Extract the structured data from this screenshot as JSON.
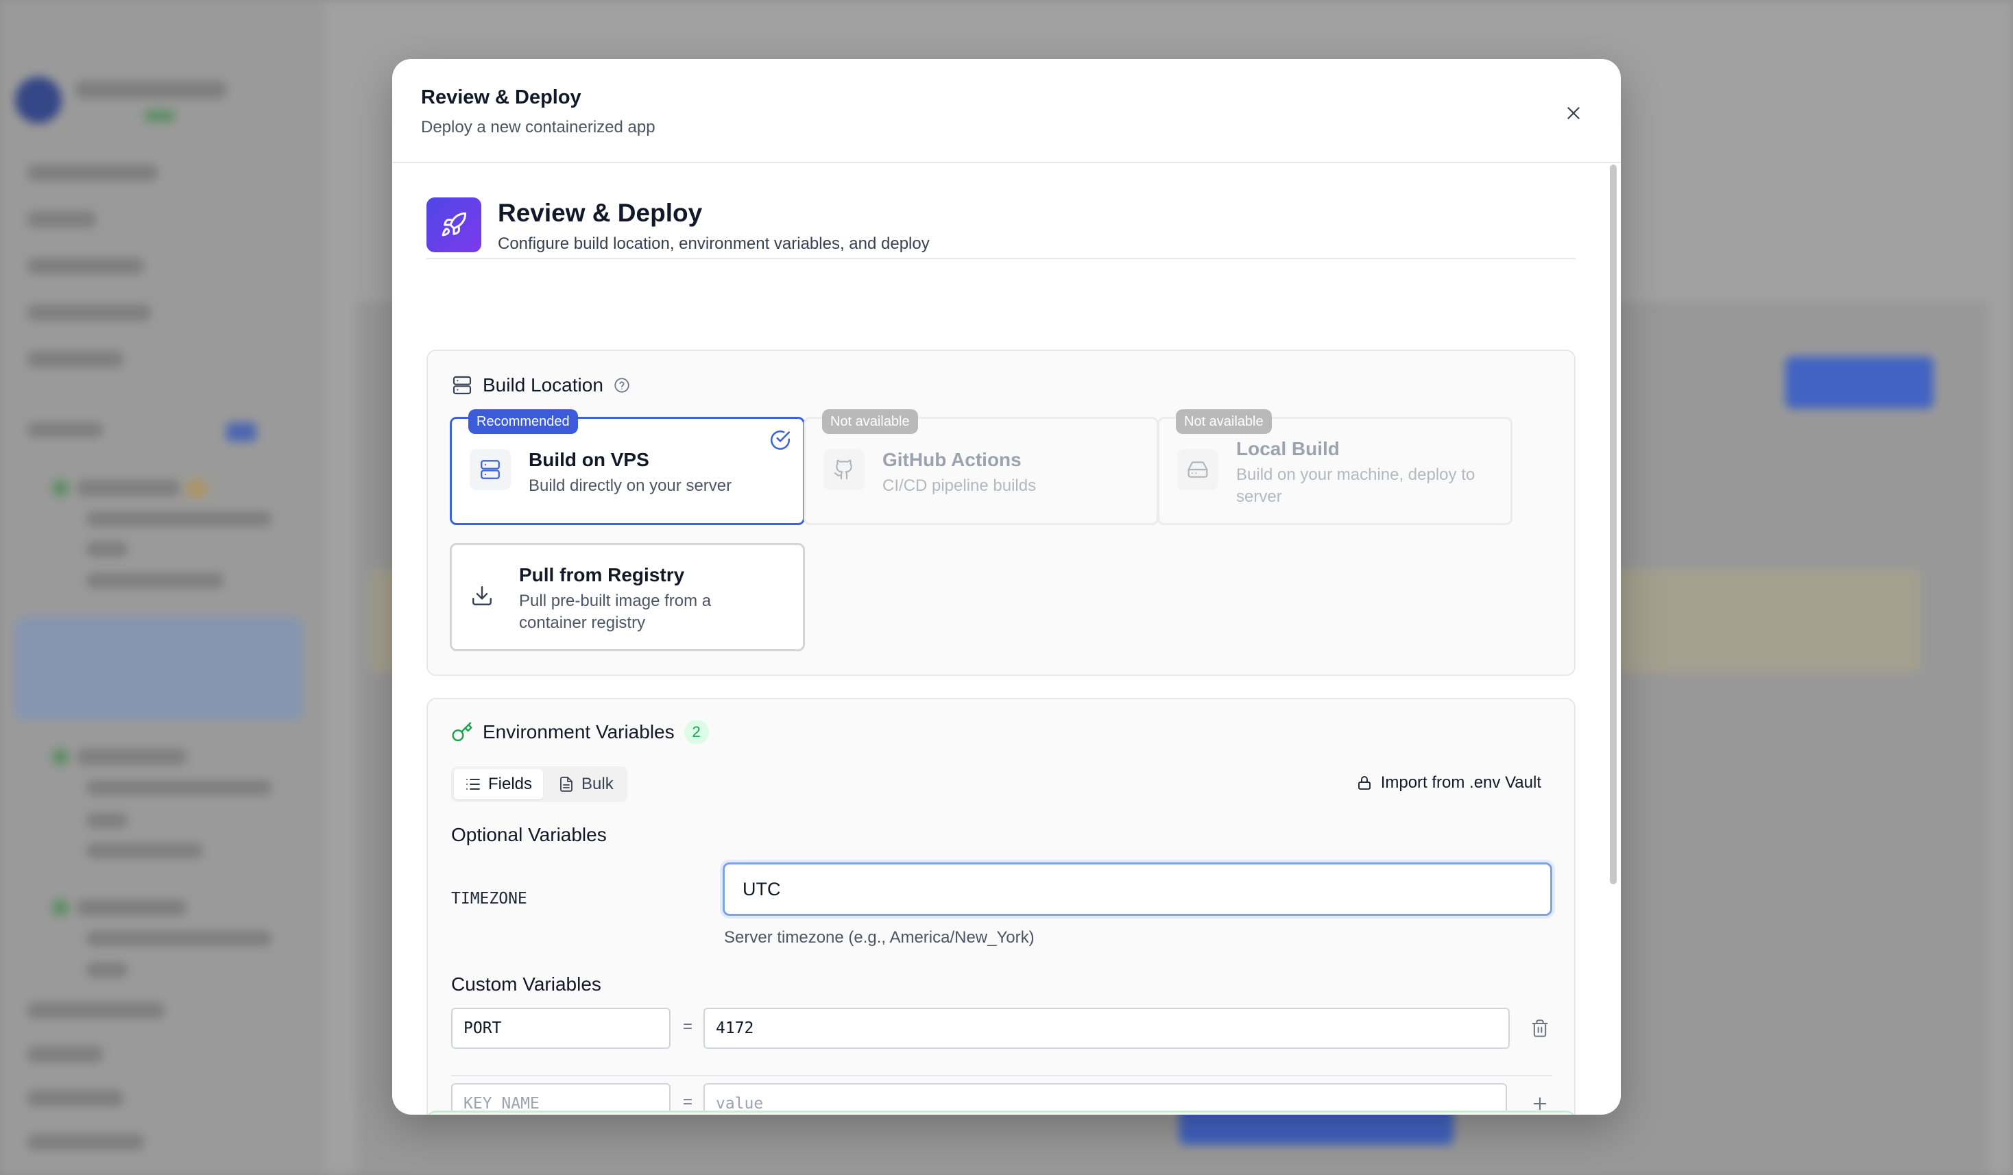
{
  "modal": {
    "title": "Review & Deploy",
    "subtitle": "Deploy a new containerized app"
  },
  "hero": {
    "title": "Review & Deploy",
    "subtitle": "Configure build location, environment variables, and deploy"
  },
  "build_location": {
    "title": "Build Location",
    "options": [
      {
        "title": "Build on VPS",
        "description": "Build directly on your server",
        "tag": "Recommended",
        "selected": true,
        "available": true,
        "icon": "server-icon"
      },
      {
        "title": "GitHub Actions",
        "description": "CI/CD pipeline builds",
        "tag": "Not available",
        "selected": false,
        "available": false,
        "icon": "github-icon"
      },
      {
        "title": "Local Build",
        "description": "Build on your machine, deploy to server",
        "tag": "Not available",
        "selected": false,
        "available": false,
        "icon": "hard-drive-icon"
      },
      {
        "title": "Pull from Registry",
        "description": "Pull pre-built image from a container registry",
        "tag": "",
        "selected": false,
        "available": true,
        "icon": "download-icon"
      }
    ]
  },
  "env": {
    "title": "Environment Variables",
    "count": "2",
    "tabs": [
      {
        "label": "Fields",
        "active": true
      },
      {
        "label": "Bulk",
        "active": false
      }
    ],
    "import_label": "Import from .env Vault",
    "optional_label": "Optional Variables",
    "optional": [
      {
        "key": "TIMEZONE",
        "value": "UTC",
        "help": "Server timezone (e.g., America/New_York)"
      }
    ],
    "custom_label": "Custom Variables",
    "custom": [
      {
        "key": "PORT",
        "value": "4172"
      }
    ],
    "new_key_placeholder": "KEY_NAME",
    "new_value_placeholder": "value",
    "equals": "="
  },
  "colors": {
    "accent": "#3b63db",
    "success": "#16a34a",
    "hero_gradient_start": "#4f46e5",
    "hero_gradient_end": "#7c3aed"
  }
}
